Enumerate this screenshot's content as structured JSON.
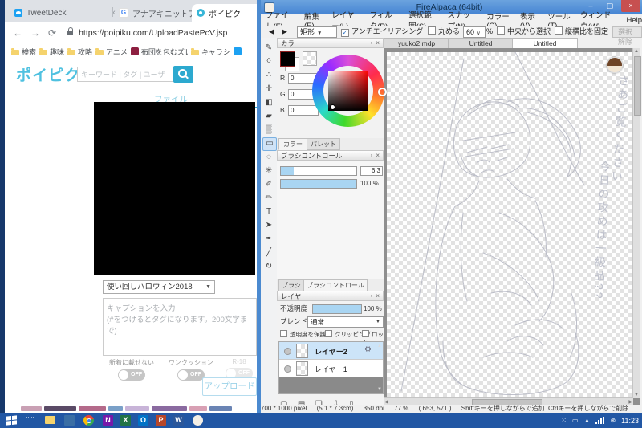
{
  "glyphs": {
    "close": "×",
    "caret_down": "▼",
    "combo_caret": "∨",
    "check": "✓",
    "float_btn": "▫",
    "min": "–",
    "max": "▢",
    "back": "←",
    "forward": "→",
    "reload": "⟳",
    "undo": "◀",
    "redo": "▶",
    "scroll_up": "▲",
    "scroll_down": "▼",
    "scroll_left": "◀",
    "scroll_right": "▶",
    "gear": "⚙"
  },
  "taskbar": {
    "clock": "11:23"
  },
  "browser": {
    "tabs": [
      {
        "title": "TweetDeck"
      },
      {
        "title": "アナアキニットアカンデ - Google 検"
      },
      {
        "title": "ポイピク"
      }
    ],
    "url": "https://poipiku.com/UploadPastePcV.jsp",
    "bookmarks": [
      "検索",
      "趣味",
      "攻略",
      "アニメ",
      "布団を包むズレない毛",
      "キャラシ"
    ],
    "page": {
      "logo": "ポイピク",
      "search_placeholder": "キーワード | タグ | ユーザ",
      "nav_tab": "ファイル",
      "preset": "使い回しハロウィン2018",
      "caption_placeholder": "キャプションを入力\n(#をつけるとタグになります。200文字まで)",
      "toggle1": "新着に載せない",
      "toggle2": "ワンクッション",
      "toggle3": "R-18",
      "off": "OFF",
      "upload": "アップロード"
    }
  },
  "fa": {
    "title": "FireAlpaca (64bit)",
    "menu": [
      "ファイル(F)",
      "編集(E)",
      "レイヤー(L)",
      "フィルタ(R)",
      "選択範囲(S)",
      "スナップ(N)",
      "カラー(C)",
      "表示(V)",
      "ツール(T)",
      "ウィンドウ(W)",
      "Help"
    ],
    "toolbar": {
      "shape": "矩形",
      "antialias": "アンチエイリアシング",
      "round": "丸める",
      "round_value": "60",
      "percent": "%",
      "from_center": "中央から選択",
      "keep_ratio": "縦横比を固定",
      "deselect": "選択解除"
    },
    "doc_tabs": [
      "yuuko2.mdp",
      "Untitled",
      "Untitled"
    ],
    "color": {
      "title": "カラー",
      "r": "R",
      "g": "G",
      "b": "B",
      "r_val": "0",
      "g_val": "0",
      "b_val": "0",
      "tab_color": "カラー",
      "tab_palette": "パレット"
    },
    "brush": {
      "title": "ブラシコントロール",
      "size": "6.3",
      "opacity": "100 %"
    },
    "dock_tabs": [
      "ブラシ",
      "ブラシコントロール"
    ],
    "layer": {
      "title": "レイヤー",
      "opacity_label": "不透明度",
      "opacity_value": "100 %",
      "blend_label": "ブレンド",
      "blend_value": "通常",
      "cb1": "透明度を保護",
      "cb2": "クリッピング",
      "cb3": "ロック",
      "layers": [
        "レイヤー2",
        "レイヤー1"
      ]
    },
    "tools": [
      {
        "name": "brush",
        "glyph": "✎"
      },
      {
        "name": "eraser",
        "glyph": "◊"
      },
      {
        "name": "dot",
        "glyph": "∴"
      },
      {
        "name": "move",
        "glyph": "✛"
      },
      {
        "name": "fill",
        "glyph": "◧"
      },
      {
        "name": "bucket",
        "glyph": "▰"
      },
      {
        "name": "gradient",
        "glyph": "▒"
      },
      {
        "name": "select-rect",
        "glyph": "▭"
      },
      {
        "name": "lasso",
        "glyph": "◌"
      },
      {
        "name": "magic-wand",
        "glyph": "✳"
      },
      {
        "name": "select-pen",
        "glyph": "✐"
      },
      {
        "name": "select-eraser",
        "glyph": "✏"
      },
      {
        "name": "text",
        "glyph": "T"
      },
      {
        "name": "operation",
        "glyph": "➤"
      },
      {
        "name": "curve",
        "glyph": "✒"
      },
      {
        "name": "eyedropper",
        "glyph": "╱"
      },
      {
        "name": "hand",
        "glyph": "↻"
      }
    ],
    "layer_buttons": [
      {
        "name": "new-layer",
        "glyph": "▢"
      },
      {
        "name": "layer-folder",
        "glyph": "▤"
      },
      {
        "name": "duplicate-layer",
        "glyph": "❏"
      },
      {
        "name": "merge-layer",
        "glyph": "⇩"
      },
      {
        "name": "delete-layer",
        "glyph": "▯"
      }
    ],
    "canvas": {
      "note1": "さあご覧ください",
      "note2": "今日の攻めは一級品??"
    },
    "status": {
      "size": "700 * 1000 pixel",
      "cm": "(5.1 * 7.3cm)",
      "dpi": "350 dpi",
      "zoom": "77 %",
      "coords": "( 653, 571 )",
      "hint": "Shiftキーを押しながらで追加. Ctrlキーを押しながらで削除"
    }
  }
}
